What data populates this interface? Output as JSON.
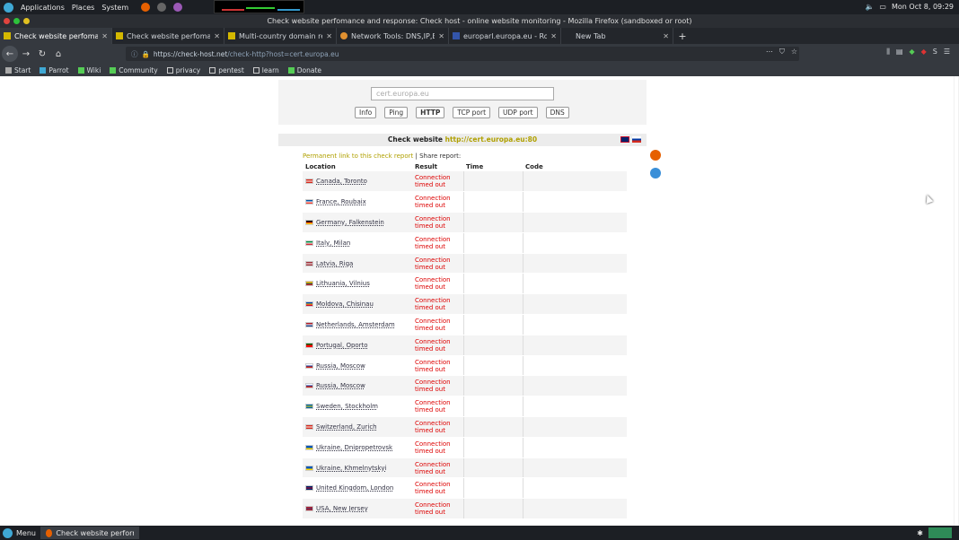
{
  "os": {
    "menu": [
      "Applications",
      "Places",
      "System"
    ],
    "clock": "Mon Oct 8, 09:29"
  },
  "window": {
    "title": "Check website perfomance and response: Check host - online website monitoring - Mozilla Firefox (sandboxed or root)"
  },
  "tabs": [
    {
      "label": "Check website perfomanc",
      "active": true
    },
    {
      "label": "Check website perfoman",
      "active": false
    },
    {
      "label": "Multi-country domain res",
      "active": false
    },
    {
      "label": "Network Tools: DNS,IP,E",
      "active": false
    },
    {
      "label": "europarl.europa.eu - Rob",
      "active": false
    },
    {
      "label": "New Tab",
      "active": false
    }
  ],
  "nav": {
    "url_host": "https://check-host.net",
    "url_path": "/check-http?host=cert.europa.eu"
  },
  "bookmarks": [
    "Start",
    "Parrot",
    "Wiki",
    "Community",
    "privacy",
    "pentest",
    "learn",
    "Donate"
  ],
  "page": {
    "search_value": "cert.europa.eu",
    "buttons": [
      "Info",
      "Ping",
      "HTTP",
      "TCP port",
      "UDP port",
      "DNS"
    ],
    "check_prefix": "Check website",
    "check_url": "http://cert.europa.eu:80",
    "permanent_link": "Permanent link to this check report",
    "share": "| Share report:",
    "headers": {
      "location": "Location",
      "result": "Result",
      "time": "Time",
      "code": "Code"
    },
    "rows": [
      {
        "location": "Canada, Toronto",
        "r1": "Connection",
        "r2": "timed out",
        "flag": [
          "#d52b1e",
          "#fff",
          "#d52b1e"
        ]
      },
      {
        "location": "France, Roubaix",
        "r1": "Connection",
        "r2": "timed out",
        "flag": [
          "#0055a4",
          "#fff",
          "#ef4135"
        ]
      },
      {
        "location": "Germany, Falkenstein",
        "r1": "Connection",
        "r2": "timed out",
        "flag": [
          "#000",
          "#dd0000",
          "#ffce00"
        ]
      },
      {
        "location": "Italy, Milan",
        "r1": "Connection",
        "r2": "timed out",
        "flag": [
          "#009246",
          "#fff",
          "#ce2b37"
        ]
      },
      {
        "location": "Latvia, Riga",
        "r1": "Connection",
        "r2": "timed out",
        "flag": [
          "#9e3039",
          "#fff",
          "#9e3039"
        ]
      },
      {
        "location": "Lithuania, Vilnius",
        "r1": "Connection",
        "r2": "timed out",
        "flag": [
          "#fdb913",
          "#006a44",
          "#c1272d"
        ]
      },
      {
        "location": "Moldova, Chisinau",
        "r1": "Connection",
        "r2": "timed out",
        "flag": [
          "#0046ae",
          "#ffd200",
          "#cc092f"
        ]
      },
      {
        "location": "Netherlands, Amsterdam",
        "r1": "Connection",
        "r2": "timed out",
        "flag": [
          "#ae1c28",
          "#fff",
          "#21468b"
        ]
      },
      {
        "location": "Portugal, Oporto",
        "r1": "Connection",
        "r2": "timed out",
        "flag": [
          "#006600",
          "#ff0000",
          "#ff0000"
        ]
      },
      {
        "location": "Russia, Moscow",
        "r1": "Connection",
        "r2": "timed out",
        "flag": [
          "#fff",
          "#0039a6",
          "#d52b1e"
        ]
      },
      {
        "location": "Russia, Moscow",
        "r1": "Connection",
        "r2": "timed out",
        "flag": [
          "#fff",
          "#0039a6",
          "#d52b1e"
        ]
      },
      {
        "location": "Sweden, Stockholm",
        "r1": "Connection",
        "r2": "timed out",
        "flag": [
          "#006aa7",
          "#fecc00",
          "#006aa7"
        ]
      },
      {
        "location": "Switzerland, Zurich",
        "r1": "Connection",
        "r2": "timed out",
        "flag": [
          "#d52b1e",
          "#fff",
          "#d52b1e"
        ]
      },
      {
        "location": "Ukraine, Dnipropetrovsk",
        "r1": "Connection",
        "r2": "timed out",
        "flag": [
          "#0057b7",
          "#0057b7",
          "#ffd700"
        ]
      },
      {
        "location": "Ukraine, Khmelnytskyi",
        "r1": "Connection",
        "r2": "timed out",
        "flag": [
          "#0057b7",
          "#0057b7",
          "#ffd700"
        ]
      },
      {
        "location": "United Kingdom, London",
        "r1": "Connection",
        "r2": "timed out",
        "flag": [
          "#012169",
          "#c8102e",
          "#012169"
        ]
      },
      {
        "location": "USA, New Jersey",
        "r1": "Connection",
        "r2": "timed out",
        "flag": [
          "#b22234",
          "#3c3b6e",
          "#b22234"
        ]
      }
    ]
  },
  "taskbar": {
    "menu": "Menu",
    "task": "Check website performa..."
  },
  "colors": {
    "result_error": "#dd0000",
    "link_url": "#b0a000",
    "accent": "#3fa8d4"
  }
}
